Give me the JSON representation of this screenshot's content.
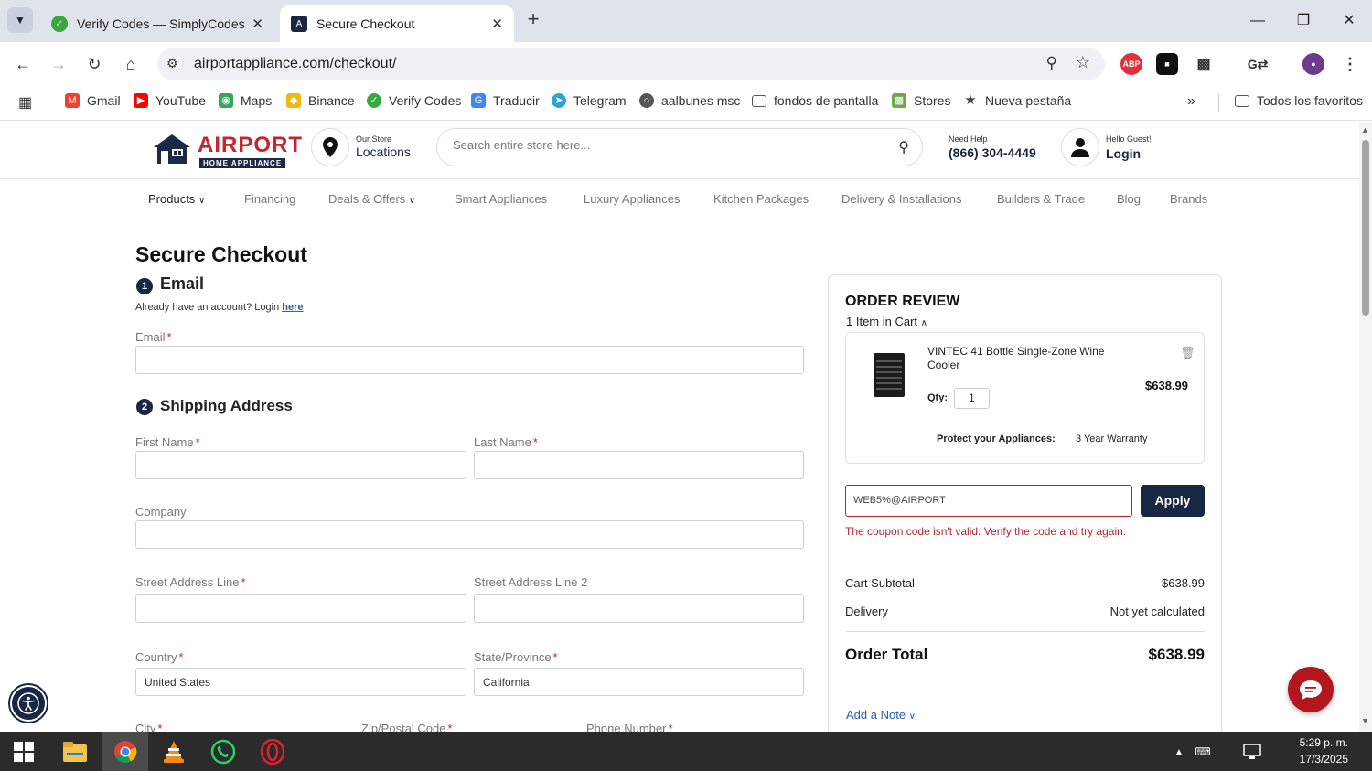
{
  "browser": {
    "tabs": [
      {
        "title": "Verify Codes — SimplyCodes",
        "active": false
      },
      {
        "title": "Secure Checkout",
        "active": true
      }
    ],
    "url": "airportappliance.com/checkout/",
    "bookmarks": [
      {
        "label": "Gmail",
        "icon": "gmail-icon",
        "color": "#ea4335"
      },
      {
        "label": "YouTube",
        "icon": "youtube-icon",
        "color": "#ff0000"
      },
      {
        "label": "Maps",
        "icon": "maps-icon",
        "color": "#34a853"
      },
      {
        "label": "Binance",
        "icon": "binance-icon",
        "color": "#f0b90b"
      },
      {
        "label": "Verify Codes",
        "icon": "verify-codes-icon",
        "color": "#3aa640"
      },
      {
        "label": "Traducir",
        "icon": "translate-icon",
        "color": "#4285f4"
      },
      {
        "label": "Telegram",
        "icon": "telegram-icon",
        "color": "#2aa3dc"
      },
      {
        "label": "aalbunes msc",
        "icon": "globe-icon",
        "color": "#555555"
      },
      {
        "label": "fondos de pantalla",
        "icon": "folder-icon",
        "color": "#555555"
      },
      {
        "label": "Stores",
        "icon": "stores-icon",
        "color": "#6aa84f"
      },
      {
        "label": "Nueva pestaña",
        "icon": "star-icon",
        "color": "#444444"
      }
    ],
    "all_bookmarks": "Todos los favoritos",
    "extension_abp": "ABP"
  },
  "header": {
    "brand": "AIRPORT",
    "brand_sub": "HOME APPLIANCE",
    "store_small": "Our Store",
    "store_big": "Locations",
    "search_placeholder": "Search entire store here...",
    "help_small": "Need Help",
    "help_phone": "(866) 304-4449",
    "user_small": "Hello Guest!",
    "user_big": "Login"
  },
  "nav": [
    "Products",
    "Financing",
    "Deals & Offers",
    "Smart Appliances",
    "Luxury Appliances",
    "Kitchen Packages",
    "Delivery & Installations",
    "Builders & Trade",
    "Blog",
    "Brands"
  ],
  "checkout": {
    "title": "Secure Checkout",
    "step1_num": "1",
    "step1_title": "Email",
    "account_note": "Already have an account? Login",
    "account_link": "here",
    "email_label": "Email",
    "step2_num": "2",
    "step2_title": "Shipping Address",
    "first_name_label": "First Name",
    "last_name_label": "Last Name",
    "company_label": "Company",
    "street1_label": "Street Address Line",
    "street2_label": "Street Address Line 2",
    "country_label": "Country",
    "country_value": "United States",
    "state_label": "State/Province",
    "state_value": "California",
    "city_label": "City",
    "zip_label": "Zip/Postal Code",
    "phone_label": "Phone Number",
    "required_mark": "*"
  },
  "review": {
    "title": "ORDER REVIEW",
    "items_count": "1 Item in Cart",
    "item_name": "VINTEC 41 Bottle Single-Zone Wine Cooler",
    "item_price": "$638.99",
    "qty_label": "Qty:",
    "qty_value": "1",
    "protect_label": "Protect your Appliances:",
    "warranty": "3 Year Warranty",
    "coupon_value": "WEB5%@AIRPORT",
    "apply_label": "Apply",
    "coupon_error": "The coupon code isn't valid. Verify the code and try again.",
    "subtotal_label": "Cart Subtotal",
    "subtotal_value": "$638.99",
    "delivery_label": "Delivery",
    "delivery_value": "Not yet calculated",
    "total_label": "Order Total",
    "total_value": "$638.99",
    "add_note": "Add a Note"
  },
  "taskbar": {
    "time": "5:29 p. m.",
    "date": "17/3/2025"
  },
  "colors": {
    "brand_red": "#c7252b",
    "navy": "#1a2744",
    "error_red": "#b3262d",
    "link_blue": "#1f5fb0"
  }
}
